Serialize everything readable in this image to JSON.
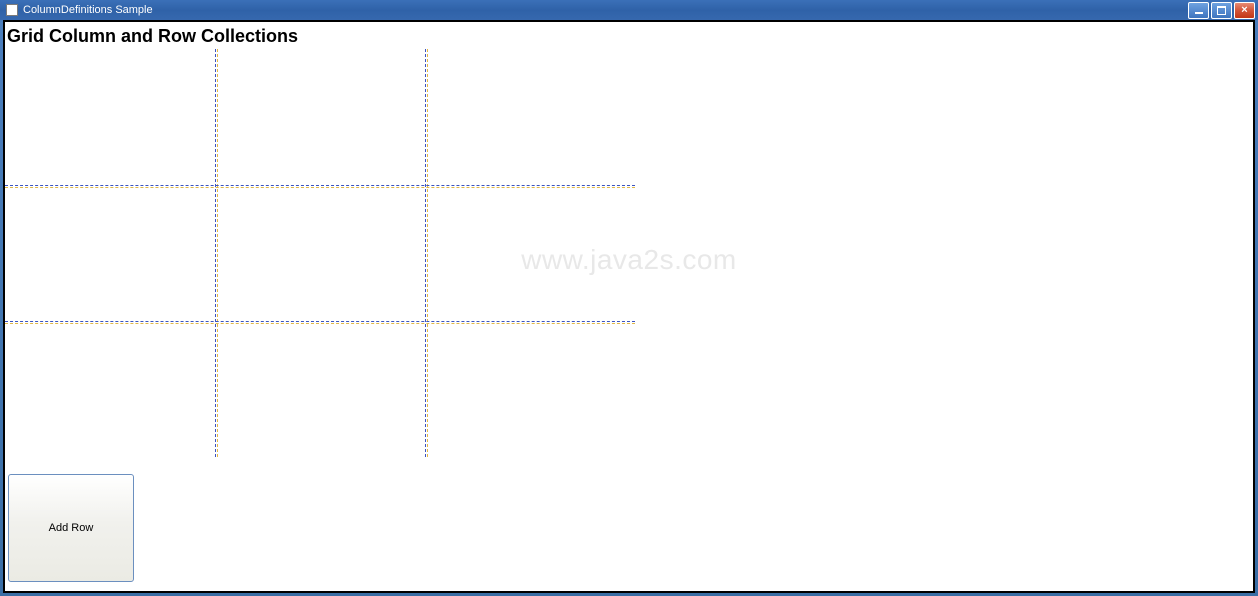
{
  "window": {
    "title": "ColumnDefinitions Sample"
  },
  "header": {
    "title": "Grid Column and Row Collections"
  },
  "watermark": "www.java2s.com",
  "buttons": {
    "add_row": "Add Row"
  },
  "grid": {
    "columns": 3,
    "rows": 3
  }
}
